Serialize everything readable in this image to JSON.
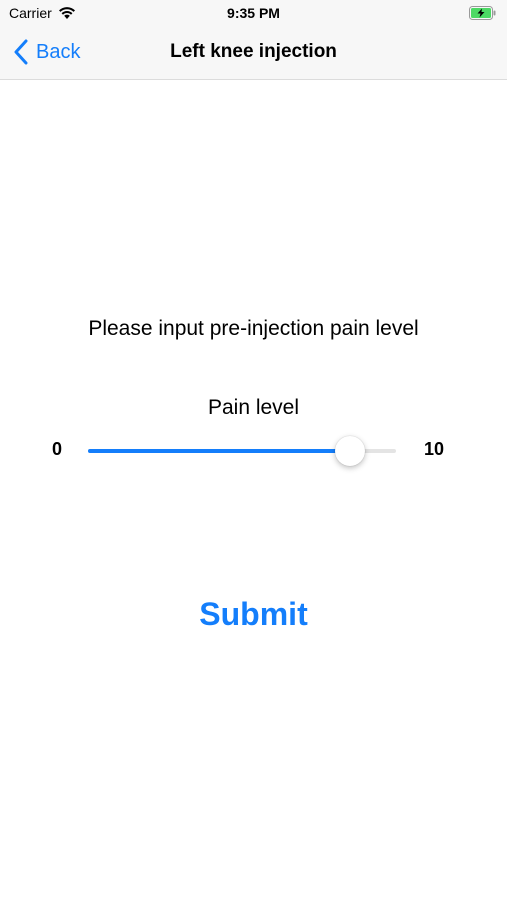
{
  "status_bar": {
    "carrier": "Carrier",
    "time": "9:35 PM",
    "icons": [
      "wifi-icon",
      "battery-charging-icon"
    ]
  },
  "nav": {
    "back_label": "Back",
    "title": "Left knee injection"
  },
  "content": {
    "prompt": "Please input pre-injection pain level",
    "slider": {
      "label": "Pain level",
      "min_label": "0",
      "max_label": "10",
      "min": 0,
      "max": 10,
      "value": 8.5
    },
    "submit_label": "Submit"
  },
  "colors": {
    "accent": "#147efb",
    "track": "#e4e4e4"
  }
}
